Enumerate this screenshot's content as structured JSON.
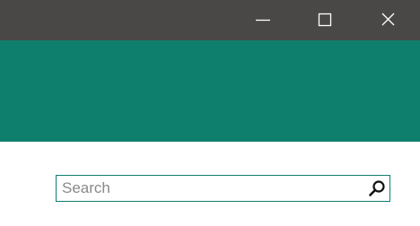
{
  "window": {
    "controls": {
      "minimize_icon": "minimize-icon",
      "maximize_icon": "maximize-icon",
      "close_icon": "close-icon"
    },
    "titlebar_color": "#4a4847"
  },
  "banner": {
    "color": "#0f7f6d"
  },
  "search": {
    "value": "",
    "placeholder": "Search",
    "icon": "search-icon",
    "border_color": "#0f7f6d"
  }
}
